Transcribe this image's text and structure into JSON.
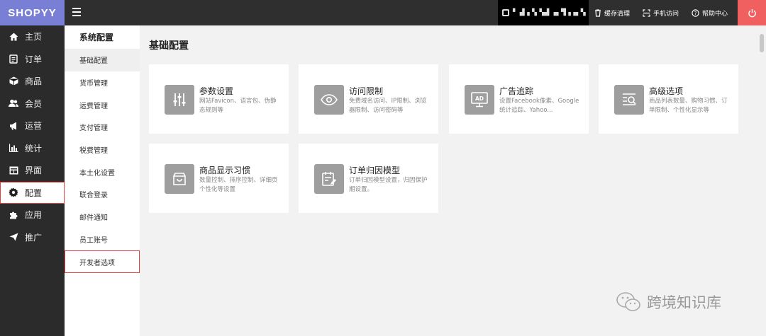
{
  "topbar": {
    "logo": "SHOPYY",
    "store_name": "▘ ▟▗▝▖▚▟ ▗▖▜▗▗▖▚",
    "actions": [
      {
        "label": "缓存清理",
        "icon": "trash-icon"
      },
      {
        "label": "手机访问",
        "icon": "scan-icon"
      },
      {
        "label": "帮助中心",
        "icon": "help-icon"
      }
    ],
    "power_color": "#f06060"
  },
  "leftnav": {
    "items": [
      {
        "label": "主页",
        "icon": "home-icon"
      },
      {
        "label": "订单",
        "icon": "order-icon"
      },
      {
        "label": "商品",
        "icon": "box-icon"
      },
      {
        "label": "会员",
        "icon": "users-icon"
      },
      {
        "label": "运营",
        "icon": "megaphone-icon"
      },
      {
        "label": "统计",
        "icon": "bar-chart-icon"
      },
      {
        "label": "界面",
        "icon": "layout-icon"
      },
      {
        "label": "配置",
        "icon": "gear-icon"
      },
      {
        "label": "应用",
        "icon": "puzzle-icon"
      },
      {
        "label": "推广",
        "icon": "send-icon"
      }
    ]
  },
  "subnav": {
    "title": "系统配置",
    "items": [
      "基础配置",
      "货币管理",
      "运费管理",
      "支付管理",
      "税费管理",
      "本土化设置",
      "联合登录",
      "邮件通知",
      "员工账号",
      "开发者选项"
    ]
  },
  "main": {
    "title": "基础配置",
    "cards": [
      {
        "title": "参数设置",
        "desc": "网站Favicon、语言包、伪静态规则等",
        "icon": "sliders-icon"
      },
      {
        "title": "访问限制",
        "desc": "免费域名访问、IP限制、浏览器限制、访问密码等",
        "icon": "eye-icon"
      },
      {
        "title": "广告追踪",
        "desc": "设置Facebook像素、Google统计追踪、Yahoo...",
        "icon": "ad-icon"
      },
      {
        "title": "高级选项",
        "desc": "商品列表数量、购物习惯、订单限制、个性化显示等",
        "icon": "search-list-icon"
      },
      {
        "title": "商品显示习惯",
        "desc": "数量控制、排序控制、详细页个性化等设置",
        "icon": "bag-icon"
      },
      {
        "title": "订单归因模型",
        "desc": "订单归因模型设置，归因保护期设置。",
        "icon": "calendar-edit-icon"
      }
    ]
  },
  "watermark": "跨境知识库"
}
